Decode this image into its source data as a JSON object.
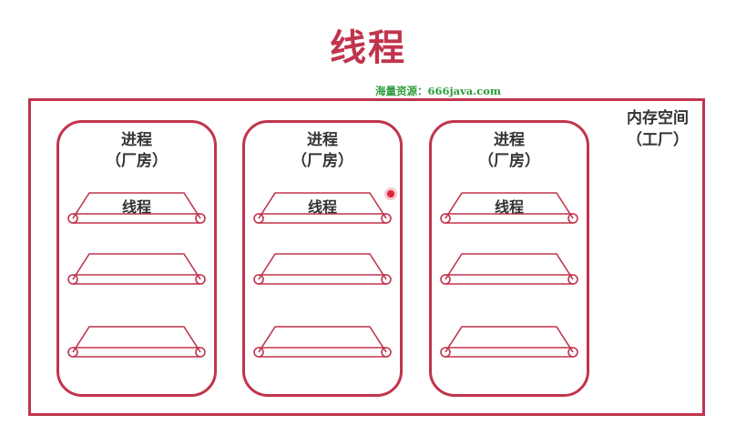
{
  "title": "线程",
  "watermark": "海量资源：666java.com",
  "memory": {
    "label_line1": "内存空间",
    "label_line2": "（工厂）"
  },
  "processes": [
    {
      "label_line1": "进程",
      "label_line2": "（厂房）",
      "threads": [
        {
          "label": "线程"
        },
        {
          "label": ""
        },
        {
          "label": ""
        }
      ]
    },
    {
      "label_line1": "进程",
      "label_line2": "（厂房）",
      "threads": [
        {
          "label": "线程"
        },
        {
          "label": ""
        },
        {
          "label": ""
        }
      ]
    },
    {
      "label_line1": "进程",
      "label_line2": "（厂房）",
      "threads": [
        {
          "label": "线程"
        },
        {
          "label": ""
        },
        {
          "label": ""
        }
      ]
    }
  ],
  "colors": {
    "accent": "#c0344d",
    "watermark": "#2e9e3c",
    "cursor": "#e0243c"
  },
  "icons": {
    "thread_shape": "conveyor-belt-icon"
  }
}
